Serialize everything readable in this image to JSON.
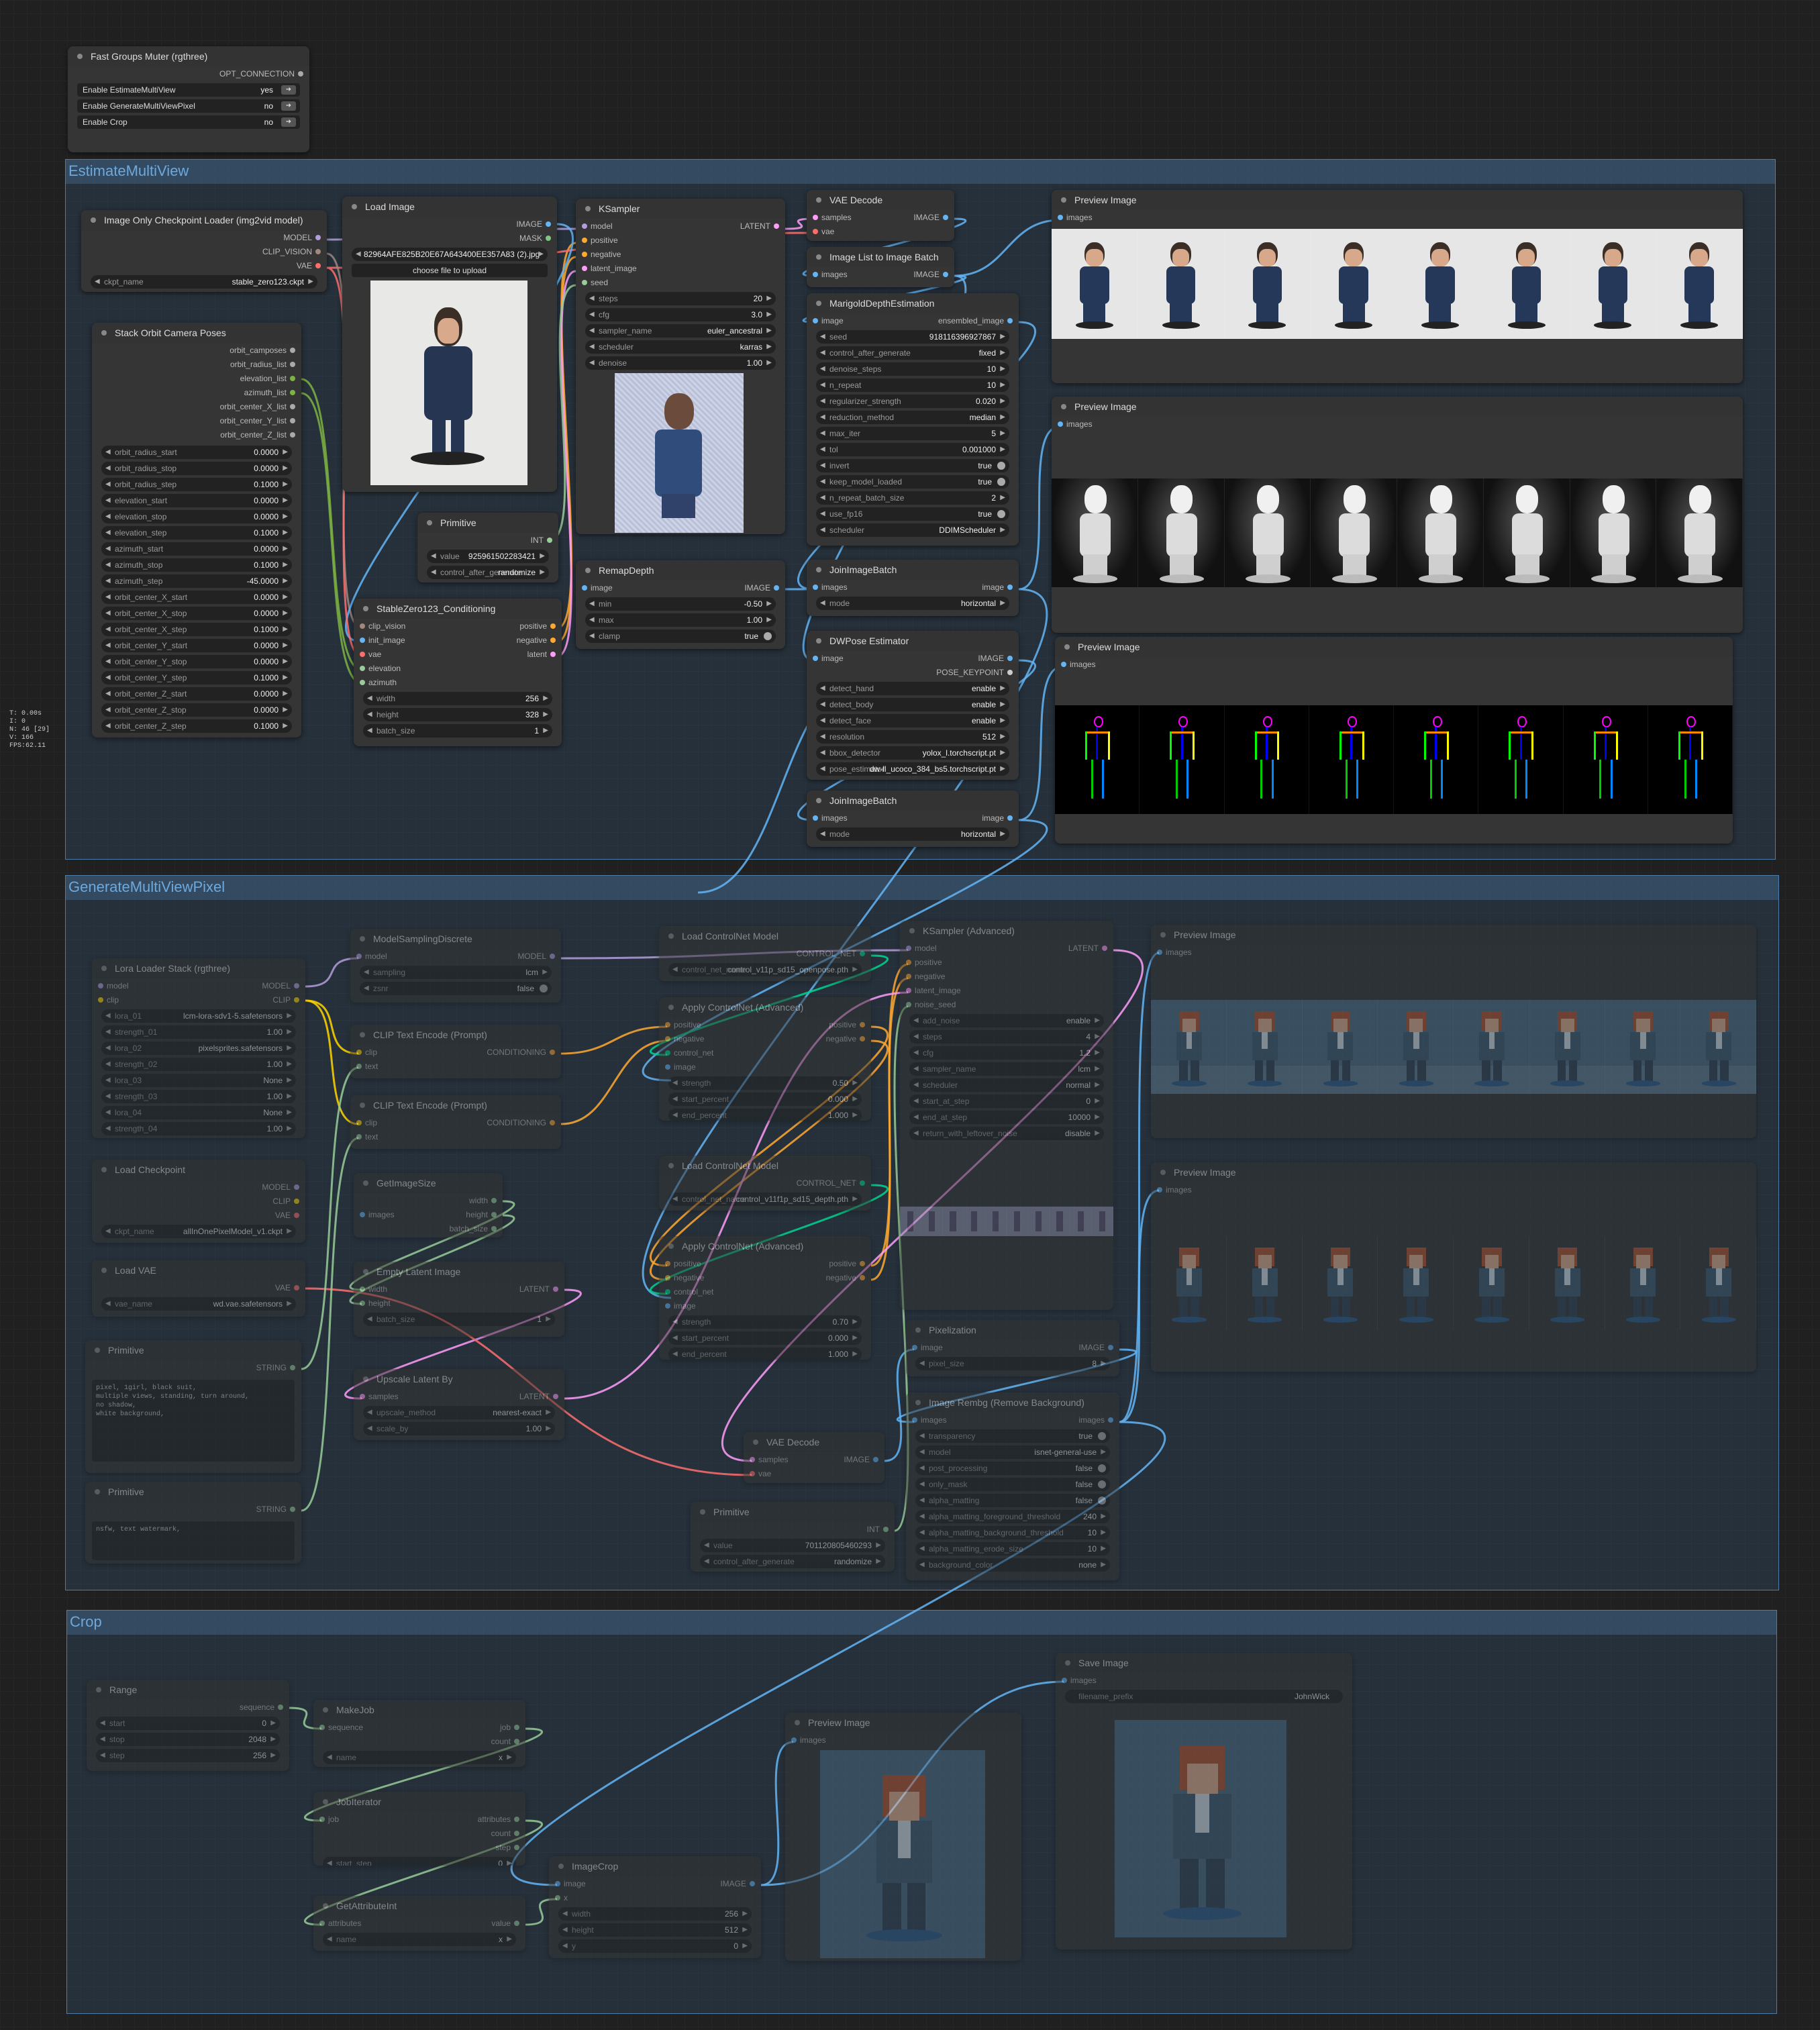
{
  "stats": [
    "T: 0.00s",
    "I: 0",
    "N: 46 [29]",
    "V: 166",
    "FPS:62.11"
  ],
  "groups": {
    "estimate": "EstimateMultiView",
    "generate": "GenerateMultiViewPixel",
    "crop": "Crop"
  },
  "muter": {
    "title": "Fast Groups Muter (rgthree)",
    "opt": "OPT_CONNECTION",
    "rows": [
      {
        "label": "Enable EstimateMultiView",
        "value": "yes"
      },
      {
        "label": "Enable GenerateMultiViewPixel",
        "value": "no"
      },
      {
        "label": "Enable Crop",
        "value": "no"
      }
    ]
  },
  "ckpt_loader": {
    "title": "Image Only Checkpoint Loader (img2vid model)",
    "outs": [
      "MODEL",
      "CLIP_VISION",
      "VAE"
    ],
    "w_label": "ckpt_name",
    "w_value": "stable_zero123.ckpt"
  },
  "load_image": {
    "title": "Load Image",
    "outs": [
      "IMAGE",
      "MASK"
    ],
    "file": "82964AFE825B20E67A643400EE357A83 (2).jpg",
    "upload": "choose file to upload"
  },
  "ksampler": {
    "title": "KSampler",
    "ins": [
      "model",
      "positive",
      "negative",
      "latent_image",
      "seed"
    ],
    "out": "LATENT",
    "widgets": [
      {
        "l": "steps",
        "v": "20"
      },
      {
        "l": "cfg",
        "v": "3.0"
      },
      {
        "l": "sampler_name",
        "v": "euler_ancestral"
      },
      {
        "l": "scheduler",
        "v": "karras"
      },
      {
        "l": "denoise",
        "v": "1.00"
      }
    ]
  },
  "vae_decode1": {
    "title": "VAE Decode",
    "ins": [
      "samples",
      "vae"
    ],
    "out": "IMAGE"
  },
  "img_list": {
    "title": "Image List to Image Batch",
    "in": "images",
    "out": "IMAGE"
  },
  "marigold": {
    "title": "MarigoldDepthEstimation",
    "in": "image",
    "out": "ensembled_image",
    "widgets": [
      {
        "l": "seed",
        "v": "918116396927867"
      },
      {
        "l": "control_after_generate",
        "v": "fixed"
      },
      {
        "l": "denoise_steps",
        "v": "10"
      },
      {
        "l": "n_repeat",
        "v": "10"
      },
      {
        "l": "regularizer_strength",
        "v": "0.020"
      },
      {
        "l": "reduction_method",
        "v": "median"
      },
      {
        "l": "max_iter",
        "v": "5"
      },
      {
        "l": "tol",
        "v": "0.001000"
      },
      {
        "l": "invert",
        "v": "true",
        "t": 1
      },
      {
        "l": "keep_model_loaded",
        "v": "true",
        "t": 1
      },
      {
        "l": "n_repeat_batch_size",
        "v": "2"
      },
      {
        "l": "use_fp16",
        "v": "true",
        "t": 1
      },
      {
        "l": "scheduler",
        "v": "DDIMScheduler"
      }
    ]
  },
  "stack_orbit": {
    "title": "Stack Orbit Camera Poses",
    "outs": [
      "orbit_camposes",
      "orbit_radius_list",
      "elevation_list",
      "azimuth_list",
      "orbit_center_X_list",
      "orbit_center_Y_list",
      "orbit_center_Z_list"
    ],
    "widgets": [
      {
        "l": "orbit_radius_start",
        "v": "0.0000"
      },
      {
        "l": "orbit_radius_stop",
        "v": "0.0000"
      },
      {
        "l": "orbit_radius_step",
        "v": "0.1000"
      },
      {
        "l": "elevation_start",
        "v": "0.0000"
      },
      {
        "l": "elevation_stop",
        "v": "0.0000"
      },
      {
        "l": "elevation_step",
        "v": "0.1000"
      },
      {
        "l": "azimuth_start",
        "v": "0.0000"
      },
      {
        "l": "azimuth_stop",
        "v": "0.1000"
      },
      {
        "l": "azimuth_step",
        "v": "-45.0000"
      },
      {
        "l": "orbit_center_X_start",
        "v": "0.0000"
      },
      {
        "l": "orbit_center_X_stop",
        "v": "0.0000"
      },
      {
        "l": "orbit_center_X_step",
        "v": "0.1000"
      },
      {
        "l": "orbit_center_Y_start",
        "v": "0.0000"
      },
      {
        "l": "orbit_center_Y_stop",
        "v": "0.0000"
      },
      {
        "l": "orbit_center_Y_step",
        "v": "0.1000"
      },
      {
        "l": "orbit_center_Z_start",
        "v": "0.0000"
      },
      {
        "l": "orbit_center_Z_stop",
        "v": "0.0000"
      },
      {
        "l": "orbit_center_Z_step",
        "v": "0.1000"
      }
    ]
  },
  "primitive1": {
    "title": "Primitive",
    "out": "INT",
    "widgets": [
      {
        "l": "value",
        "v": "925961502283421"
      },
      {
        "l": "control_after_generate",
        "v": "randomize"
      }
    ]
  },
  "sz_cond": {
    "title": "StableZero123_Conditioning",
    "ins": [
      "clip_vision",
      "init_image",
      "vae",
      "elevation",
      "azimuth"
    ],
    "outs": [
      "positive",
      "negative",
      "latent"
    ],
    "widgets": [
      {
        "l": "width",
        "v": "256"
      },
      {
        "l": "height",
        "v": "328"
      },
      {
        "l": "batch_size",
        "v": "1"
      }
    ]
  },
  "remap": {
    "title": "RemapDepth",
    "in": "image",
    "out": "IMAGE",
    "widgets": [
      {
        "l": "min",
        "v": "-0.50"
      },
      {
        "l": "max",
        "v": "1.00"
      },
      {
        "l": "clamp",
        "v": "true",
        "t": 1
      }
    ]
  },
  "join1": {
    "title": "JoinImageBatch",
    "in": "images",
    "out": "image",
    "w_l": "mode",
    "w_v": "horizontal"
  },
  "dwpose": {
    "title": "DWPose Estimator",
    "in": "image",
    "outs": [
      "IMAGE",
      "POSE_KEYPOINT"
    ],
    "widgets": [
      {
        "l": "detect_hand",
        "v": "enable"
      },
      {
        "l": "detect_body",
        "v": "enable"
      },
      {
        "l": "detect_face",
        "v": "enable"
      },
      {
        "l": "resolution",
        "v": "512"
      },
      {
        "l": "bbox_detector",
        "v": "yolox_l.torchscript.pt"
      },
      {
        "l": "pose_estimator",
        "v": "dw-ll_ucoco_384_bs5.torchscript.pt"
      }
    ]
  },
  "join2": {
    "title": "JoinImageBatch",
    "in": "images",
    "out": "image",
    "w_l": "mode",
    "w_v": "horizontal"
  },
  "preview1": {
    "title": "Preview Image",
    "in": "images"
  },
  "preview2": {
    "title": "Preview Image",
    "in": "images"
  },
  "preview3": {
    "title": "Preview Image",
    "in": "images"
  },
  "lora": {
    "title": "Lora Loader Stack (rgthree)",
    "ins": [
      "model",
      "clip"
    ],
    "outs": [
      "MODEL",
      "CLIP"
    ],
    "widgets": [
      {
        "l": "lora_01",
        "v": "lcm-lora-sdv1-5.safetensors"
      },
      {
        "l": "strength_01",
        "v": "1.00"
      },
      {
        "l": "lora_02",
        "v": "pixelsprites.safetensors"
      },
      {
        "l": "strength_02",
        "v": "1.00"
      },
      {
        "l": "lora_03",
        "v": "None"
      },
      {
        "l": "strength_03",
        "v": "1.00"
      },
      {
        "l": "lora_04",
        "v": "None"
      },
      {
        "l": "strength_04",
        "v": "1.00"
      }
    ]
  },
  "msd": {
    "title": "ModelSamplingDiscrete",
    "in": "model",
    "out": "MODEL",
    "widgets": [
      {
        "l": "sampling",
        "v": "lcm"
      },
      {
        "l": "zsnr",
        "v": "false",
        "t": 1
      }
    ]
  },
  "clip_enc1": {
    "title": "CLIP Text Encode (Prompt)",
    "ins": [
      "clip",
      "text"
    ],
    "out": "CONDITIONING"
  },
  "clip_enc2": {
    "title": "CLIP Text Encode (Prompt)",
    "ins": [
      "clip",
      "text"
    ],
    "out": "CONDITIONING"
  },
  "load_ckpt": {
    "title": "Load Checkpoint",
    "outs": [
      "MODEL",
      "CLIP",
      "VAE"
    ],
    "w_l": "ckpt_name",
    "w_v": "allInOnePixelModel_v1.ckpt"
  },
  "load_vae": {
    "title": "Load VAE",
    "out": "VAE",
    "w_l": "vae_name",
    "w_v": "wd.vae.safetensors"
  },
  "getsize": {
    "title": "GetImageSize",
    "in": "images",
    "outs": [
      "width",
      "height",
      "batch_size"
    ]
  },
  "empty_latent": {
    "title": "Empty Latent Image",
    "ins": [
      "width",
      "height"
    ],
    "out": "LATENT",
    "w_l": "batch_size",
    "w_v": "1"
  },
  "upscale_latent": {
    "title": "Upscale Latent By",
    "in": "samples",
    "out": "LATENT",
    "widgets": [
      {
        "l": "upscale_method",
        "v": "nearest-exact"
      },
      {
        "l": "scale_by",
        "v": "1.00"
      }
    ]
  },
  "primitive2": {
    "title": "Primitive",
    "out": "STRING",
    "text": "pixel, 1girl, black suit,\nmultiple views, standing, turn around,\nno shadow,\nwhite background,"
  },
  "primitive3": {
    "title": "Primitive",
    "out": "STRING",
    "text": "nsfw, text watermark,"
  },
  "cn_load1": {
    "title": "Load ControlNet Model",
    "out": "CONTROL_NET",
    "w_l": "control_net_name",
    "w_v": "control_v11p_sd15_openpose.pth"
  },
  "cn_apply1": {
    "title": "Apply ControlNet (Advanced)",
    "ins": [
      "positive",
      "negative",
      "control_net",
      "image"
    ],
    "outs": [
      "positive",
      "negative"
    ],
    "widgets": [
      {
        "l": "strength",
        "v": "0.50"
      },
      {
        "l": "start_percent",
        "v": "0.000"
      },
      {
        "l": "end_percent",
        "v": "1.000"
      }
    ]
  },
  "cn_load2": {
    "title": "Load ControlNet Model",
    "out": "CONTROL_NET",
    "w_l": "control_net_name",
    "w_v": "control_v11f1p_sd15_depth.pth"
  },
  "cn_apply2": {
    "title": "Apply ControlNet (Advanced)",
    "ins": [
      "positive",
      "negative",
      "control_net",
      "image"
    ],
    "outs": [
      "positive",
      "negative"
    ],
    "widgets": [
      {
        "l": "strength",
        "v": "0.70"
      },
      {
        "l": "start_percent",
        "v": "0.000"
      },
      {
        "l": "end_percent",
        "v": "1.000"
      }
    ]
  },
  "ksampler_adv": {
    "title": "KSampler (Advanced)",
    "ins": [
      "model",
      "positive",
      "negative",
      "latent_image",
      "noise_seed"
    ],
    "out": "LATENT",
    "widgets": [
      {
        "l": "add_noise",
        "v": "enable"
      },
      {
        "l": "steps",
        "v": "4"
      },
      {
        "l": "cfg",
        "v": "1.2"
      },
      {
        "l": "sampler_name",
        "v": "lcm"
      },
      {
        "l": "scheduler",
        "v": "normal"
      },
      {
        "l": "start_at_step",
        "v": "0"
      },
      {
        "l": "end_at_step",
        "v": "10000"
      },
      {
        "l": "return_with_leftover_noise",
        "v": "disable"
      }
    ]
  },
  "preview4": {
    "title": "Preview Image",
    "in": "images"
  },
  "preview5": {
    "title": "Preview Image",
    "in": "images"
  },
  "pixelization": {
    "title": "Pixelization",
    "in": "image",
    "out": "IMAGE",
    "w_l": "pixel_size",
    "w_v": "8"
  },
  "rembg": {
    "title": "Image Rembg (Remove Background)",
    "in": "images",
    "out": "images",
    "widgets": [
      {
        "l": "transparency",
        "v": "true",
        "t": 1
      },
      {
        "l": "model",
        "v": "isnet-general-use"
      },
      {
        "l": "post_processing",
        "v": "false",
        "t": 1
      },
      {
        "l": "only_mask",
        "v": "false",
        "t": 1
      },
      {
        "l": "alpha_matting",
        "v": "false",
        "t": 1
      },
      {
        "l": "alpha_matting_foreground_threshold",
        "v": "240"
      },
      {
        "l": "alpha_matting_background_threshold",
        "v": "10"
      },
      {
        "l": "alpha_matting_erode_size",
        "v": "10"
      },
      {
        "l": "background_color",
        "v": "none"
      }
    ]
  },
  "vae_decode2": {
    "title": "VAE Decode",
    "ins": [
      "samples",
      "vae"
    ],
    "out": "IMAGE"
  },
  "primitive4": {
    "title": "Primitive",
    "out": "INT",
    "widgets": [
      {
        "l": "value",
        "v": "701120805460293"
      },
      {
        "l": "control_after_generate",
        "v": "randomize"
      }
    ]
  },
  "range": {
    "title": "Range",
    "out": "sequence",
    "widgets": [
      {
        "l": "start",
        "v": "0"
      },
      {
        "l": "stop",
        "v": "2048"
      },
      {
        "l": "step",
        "v": "256"
      }
    ]
  },
  "makejob": {
    "title": "MakeJob",
    "in": "sequence",
    "outs": [
      "job",
      "count"
    ],
    "w_l": "name",
    "w_v": "x"
  },
  "jobiterator": {
    "title": "JobIterator",
    "in": "job",
    "outs": [
      "attributes",
      "count",
      "step"
    ],
    "w_l": "start_step",
    "w_v": "0"
  },
  "getattr": {
    "title": "GetAttributeInt",
    "in": "attributes",
    "out": "value",
    "w_l": "name",
    "w_v": "x"
  },
  "imagecrop": {
    "title": "ImageCrop",
    "ins": [
      "image",
      "x"
    ],
    "out": "IMAGE",
    "widgets": [
      {
        "l": "width",
        "v": "256"
      },
      {
        "l": "height",
        "v": "512"
      },
      {
        "l": "y",
        "v": "0"
      }
    ]
  },
  "preview6": {
    "title": "Preview Image",
    "in": "images"
  },
  "save": {
    "title": "Save Image",
    "in": "images",
    "w_l": "filename_prefix",
    "w_v": "JohnWick"
  },
  "colors": {
    "bg": "#202020",
    "group": "#3a6996",
    "node": "#353535",
    "model": "#b39ddb",
    "clip": "#ffd500",
    "vae": "#ff6e6e",
    "image": "#64b5f6",
    "latent": "#ff9cf9",
    "cond": "#ffa931",
    "int": "#29699c"
  }
}
